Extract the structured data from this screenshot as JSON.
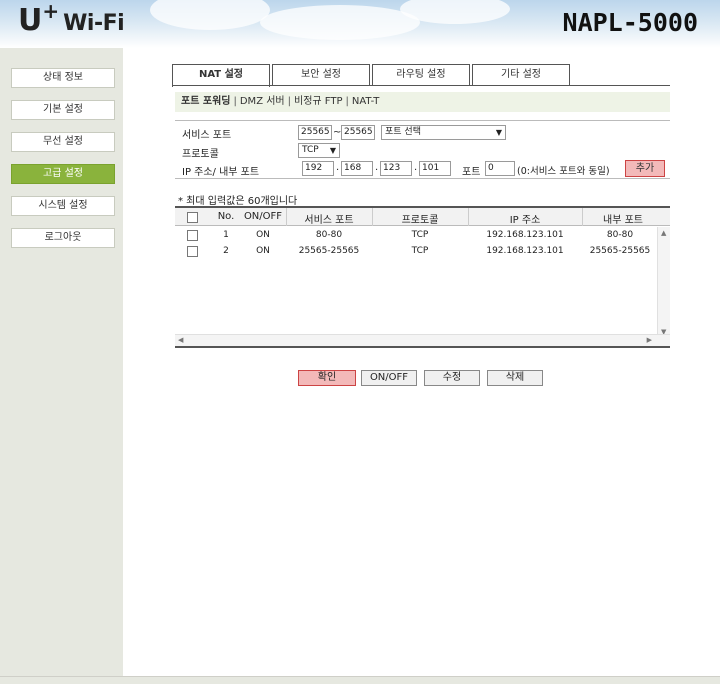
{
  "header": {
    "logo_u": "U",
    "logo_plus": "+",
    "logo_wifi": "Wi-Fi",
    "model": "NAPL-5000"
  },
  "sidebar": {
    "items": [
      {
        "label": "상태 정보"
      },
      {
        "label": "기본 설정"
      },
      {
        "label": "무선 설정"
      },
      {
        "label": "고급 설정",
        "active": true
      },
      {
        "label": "시스템 설정"
      },
      {
        "label": "로그아웃"
      }
    ]
  },
  "tabs": [
    {
      "label": "NAT 설정",
      "active": true
    },
    {
      "label": "보안 설정"
    },
    {
      "label": "라우팅 설정"
    },
    {
      "label": "기타 설정"
    }
  ],
  "subnav": {
    "items": [
      "포트 포워딩",
      "DMZ 서버",
      "비정규 FTP",
      "NAT-T"
    ],
    "separator": "|"
  },
  "form": {
    "service_port_label": "서비스 포트",
    "port_from": "25565",
    "tilde": "~",
    "port_to": "25565",
    "port_select": "포트 선택",
    "protocol_label": "프로토콜",
    "protocol_value": "TCP",
    "ip_label": "IP 주소/ 내부 포트",
    "ip1": "192",
    "ip2": "168",
    "ip3": "123",
    "ip4": "101",
    "dot": ".",
    "inner_port_label": "포트",
    "inner_port_value": "0",
    "inner_port_hint": "(0:서비스 포트와 동일)",
    "add_button": "추가"
  },
  "note": "* 최대 입력값은 60개입니다",
  "table": {
    "columns": [
      "No.",
      "ON/OFF",
      "서비스 포트",
      "프로토콜",
      "IP 주소",
      "내부 포트"
    ],
    "rows": [
      {
        "no": "1",
        "state": "ON",
        "service_port": "80-80",
        "protocol": "TCP",
        "ip": "192.168.123.101",
        "inner_port": "80-80"
      },
      {
        "no": "2",
        "state": "ON",
        "service_port": "25565-25565",
        "protocol": "TCP",
        "ip": "192.168.123.101",
        "inner_port": "25565-25565"
      }
    ]
  },
  "buttons": {
    "confirm": "확인",
    "onoff": "ON/OFF",
    "edit": "수정",
    "delete": "삭제"
  },
  "colors": {
    "sidebar_bg": "#e6e8e0",
    "active_green": "#8ab33c",
    "primary_pink": "#f3b9b9"
  }
}
